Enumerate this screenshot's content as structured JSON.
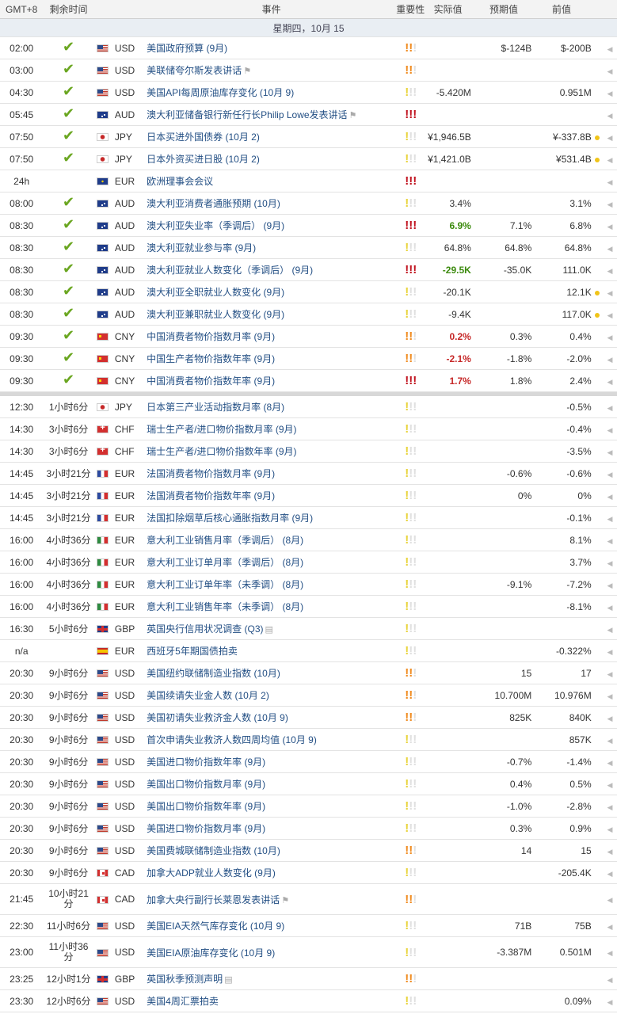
{
  "header": {
    "gmt": "GMT+8",
    "remaining": "剩余时间",
    "event": "事件",
    "importance": "重要性",
    "actual": "实际值",
    "forecast": "预期值",
    "previous": "前值"
  },
  "date_label": "星期四，10月 15",
  "importance_colors": {
    "low": "#e8d33a",
    "mid": "#f08a1e",
    "high": "#c0111d"
  },
  "rows_done": [
    {
      "time": "02:00",
      "status": "check",
      "flag": "USD",
      "cur": "USD",
      "event": "美国政府预算 (9月)",
      "imp": "mid",
      "actual": "",
      "act_style": "",
      "forecast": "$-124B",
      "previous": "$-200B",
      "dot": false
    },
    {
      "time": "03:00",
      "status": "check",
      "flag": "USD",
      "cur": "USD",
      "event": "美联储夸尔斯发表讲话",
      "icon": "speaker",
      "imp": "mid",
      "actual": "",
      "act_style": "",
      "forecast": "",
      "previous": "",
      "dot": false
    },
    {
      "time": "04:30",
      "status": "check",
      "flag": "USD",
      "cur": "USD",
      "event": "美国API每周原油库存变化 (10月 9)",
      "imp": "low",
      "actual": "-5.420M",
      "act_style": "",
      "forecast": "",
      "previous": "0.951M",
      "dot": false
    },
    {
      "time": "05:45",
      "status": "check",
      "flag": "AUD",
      "cur": "AUD",
      "event": "澳大利亚储备银行新任行长Philip Lowe发表讲话",
      "icon": "speaker",
      "imp": "high",
      "actual": "",
      "act_style": "",
      "forecast": "",
      "previous": "",
      "dot": false
    },
    {
      "time": "07:50",
      "status": "check",
      "flag": "JPY",
      "cur": "JPY",
      "event": "日本买进外国债券 (10月 2)",
      "imp": "low",
      "actual": "¥1,946.5B",
      "act_style": "",
      "forecast": "",
      "previous": "¥-337.8B",
      "dot": true
    },
    {
      "time": "07:50",
      "status": "check",
      "flag": "JPY",
      "cur": "JPY",
      "event": "日本外资买进日股 (10月 2)",
      "imp": "low",
      "actual": "¥1,421.0B",
      "act_style": "",
      "forecast": "",
      "previous": "¥531.4B",
      "dot": true
    },
    {
      "time": "24h",
      "status": "",
      "flag": "EUR",
      "cur": "EUR",
      "event": "欧洲理事会会议",
      "imp": "high",
      "actual": "",
      "act_style": "",
      "forecast": "",
      "previous": "",
      "dot": false
    },
    {
      "time": "08:00",
      "status": "check",
      "flag": "AUD",
      "cur": "AUD",
      "event": "澳大利亚消费者通胀预期 (10月)",
      "imp": "low",
      "actual": "3.4%",
      "act_style": "",
      "forecast": "",
      "previous": "3.1%",
      "dot": false
    },
    {
      "time": "08:30",
      "status": "check",
      "flag": "AUD",
      "cur": "AUD",
      "event": "澳大利亚失业率（季调后） (9月)",
      "imp": "high",
      "actual": "6.9%",
      "act_style": "good",
      "forecast": "7.1%",
      "previous": "6.8%",
      "dot": false
    },
    {
      "time": "08:30",
      "status": "check",
      "flag": "AUD",
      "cur": "AUD",
      "event": "澳大利亚就业参与率 (9月)",
      "imp": "low",
      "actual": "64.8%",
      "act_style": "",
      "forecast": "64.8%",
      "previous": "64.8%",
      "dot": false
    },
    {
      "time": "08:30",
      "status": "check",
      "flag": "AUD",
      "cur": "AUD",
      "event": "澳大利亚就业人数变化（季调后） (9月)",
      "imp": "high",
      "actual": "-29.5K",
      "act_style": "good",
      "forecast": "-35.0K",
      "previous": "111.0K",
      "dot": false
    },
    {
      "time": "08:30",
      "status": "check",
      "flag": "AUD",
      "cur": "AUD",
      "event": "澳大利亚全职就业人数变化 (9月)",
      "imp": "low",
      "actual": "-20.1K",
      "act_style": "",
      "forecast": "",
      "previous": "12.1K",
      "dot": true
    },
    {
      "time": "08:30",
      "status": "check",
      "flag": "AUD",
      "cur": "AUD",
      "event": "澳大利亚兼职就业人数变化 (9月)",
      "imp": "low",
      "actual": "-9.4K",
      "act_style": "",
      "forecast": "",
      "previous": "117.0K",
      "dot": true
    },
    {
      "time": "09:30",
      "status": "check",
      "flag": "CNY",
      "cur": "CNY",
      "event": "中国消费者物价指数月率 (9月)",
      "imp": "mid",
      "actual": "0.2%",
      "act_style": "bad",
      "forecast": "0.3%",
      "previous": "0.4%",
      "dot": false
    },
    {
      "time": "09:30",
      "status": "check",
      "flag": "CNY",
      "cur": "CNY",
      "event": "中国生产者物价指数年率 (9月)",
      "imp": "mid",
      "actual": "-2.1%",
      "act_style": "bad",
      "forecast": "-1.8%",
      "previous": "-2.0%",
      "dot": false
    },
    {
      "time": "09:30",
      "status": "check",
      "flag": "CNY",
      "cur": "CNY",
      "event": "中国消费者物价指数年率 (9月)",
      "imp": "high",
      "actual": "1.7%",
      "act_style": "bad",
      "forecast": "1.8%",
      "previous": "2.4%",
      "dot": false
    }
  ],
  "rows_upcoming": [
    {
      "time": "12:30",
      "rem": "1小时6分",
      "flag": "JPY",
      "cur": "JPY",
      "event": "日本第三产业活动指数月率 (8月)",
      "imp": "low",
      "forecast": "",
      "previous": "-0.5%"
    },
    {
      "time": "14:30",
      "rem": "3小时6分",
      "flag": "CHF",
      "cur": "CHF",
      "event": "瑞士生产者/进口物价指数月率 (9月)",
      "imp": "low",
      "forecast": "",
      "previous": "-0.4%"
    },
    {
      "time": "14:30",
      "rem": "3小时6分",
      "flag": "CHF",
      "cur": "CHF",
      "event": "瑞士生产者/进口物价指数年率 (9月)",
      "imp": "low",
      "forecast": "",
      "previous": "-3.5%"
    },
    {
      "time": "14:45",
      "rem": "3小时21分",
      "flag": "FR",
      "cur": "EUR",
      "event": "法国消费者物价指数月率 (9月)",
      "imp": "low",
      "forecast": "-0.6%",
      "previous": "-0.6%"
    },
    {
      "time": "14:45",
      "rem": "3小时21分",
      "flag": "FR",
      "cur": "EUR",
      "event": "法国消费者物价指数年率 (9月)",
      "imp": "low",
      "forecast": "0%",
      "previous": "0%"
    },
    {
      "time": "14:45",
      "rem": "3小时21分",
      "flag": "FR",
      "cur": "EUR",
      "event": "法国扣除烟草后核心通胀指数月率 (9月)",
      "imp": "low",
      "forecast": "",
      "previous": "-0.1%"
    },
    {
      "time": "16:00",
      "rem": "4小时36分",
      "flag": "IT",
      "cur": "EUR",
      "event": "意大利工业销售月率（季调后） (8月)",
      "imp": "low",
      "forecast": "",
      "previous": "8.1%"
    },
    {
      "time": "16:00",
      "rem": "4小时36分",
      "flag": "IT",
      "cur": "EUR",
      "event": "意大利工业订单月率（季调后） (8月)",
      "imp": "low",
      "forecast": "",
      "previous": "3.7%"
    },
    {
      "time": "16:00",
      "rem": "4小时36分",
      "flag": "IT",
      "cur": "EUR",
      "event": "意大利工业订单年率（未季调） (8月)",
      "imp": "low",
      "forecast": "-9.1%",
      "previous": "-7.2%"
    },
    {
      "time": "16:00",
      "rem": "4小时36分",
      "flag": "IT",
      "cur": "EUR",
      "event": "意大利工业销售年率（未季调） (8月)",
      "imp": "low",
      "forecast": "",
      "previous": "-8.1%"
    },
    {
      "time": "16:30",
      "rem": "5小时6分",
      "flag": "GBP",
      "cur": "GBP",
      "event": "英国央行信用状况调查 (Q3)",
      "icon": "doc",
      "imp": "low",
      "forecast": "",
      "previous": ""
    },
    {
      "time": "n/a",
      "rem": "",
      "flag": "ES",
      "cur": "EUR",
      "event": "西班牙5年期国债拍卖",
      "imp": "low",
      "forecast": "",
      "previous": "-0.322%"
    },
    {
      "time": "20:30",
      "rem": "9小时6分",
      "flag": "USD",
      "cur": "USD",
      "event": "美国纽约联储制造业指数 (10月)",
      "imp": "mid",
      "forecast": "15",
      "previous": "17"
    },
    {
      "time": "20:30",
      "rem": "9小时6分",
      "flag": "USD",
      "cur": "USD",
      "event": "美国续请失业金人数 (10月 2)",
      "imp": "mid",
      "forecast": "10.700M",
      "previous": "10.976M"
    },
    {
      "time": "20:30",
      "rem": "9小时6分",
      "flag": "USD",
      "cur": "USD",
      "event": "美国初请失业救济金人数 (10月 9)",
      "imp": "mid",
      "forecast": "825K",
      "previous": "840K"
    },
    {
      "time": "20:30",
      "rem": "9小时6分",
      "flag": "USD",
      "cur": "USD",
      "event": "首次申请失业救济人数四周均值 (10月 9)",
      "imp": "low",
      "forecast": "",
      "previous": "857K"
    },
    {
      "time": "20:30",
      "rem": "9小时6分",
      "flag": "USD",
      "cur": "USD",
      "event": "美国进口物价指数年率 (9月)",
      "imp": "low",
      "forecast": "-0.7%",
      "previous": "-1.4%"
    },
    {
      "time": "20:30",
      "rem": "9小时6分",
      "flag": "USD",
      "cur": "USD",
      "event": "美国出口物价指数月率 (9月)",
      "imp": "low",
      "forecast": "0.4%",
      "previous": "0.5%"
    },
    {
      "time": "20:30",
      "rem": "9小时6分",
      "flag": "USD",
      "cur": "USD",
      "event": "美国出口物价指数年率 (9月)",
      "imp": "low",
      "forecast": "-1.0%",
      "previous": "-2.8%"
    },
    {
      "time": "20:30",
      "rem": "9小时6分",
      "flag": "USD",
      "cur": "USD",
      "event": "美国进口物价指数月率 (9月)",
      "imp": "low",
      "forecast": "0.3%",
      "previous": "0.9%"
    },
    {
      "time": "20:30",
      "rem": "9小时6分",
      "flag": "USD",
      "cur": "USD",
      "event": "美国费城联储制造业指数 (10月)",
      "imp": "mid",
      "forecast": "14",
      "previous": "15"
    },
    {
      "time": "20:30",
      "rem": "9小时6分",
      "flag": "CAD",
      "cur": "CAD",
      "event": "加拿大ADP就业人数变化 (9月)",
      "imp": "low",
      "forecast": "",
      "previous": "-205.4K"
    },
    {
      "time": "21:45",
      "rem": "10小时21分",
      "flag": "CAD",
      "cur": "CAD",
      "event": "加拿大央行副行长莱恩发表讲话",
      "icon": "speaker",
      "imp": "mid",
      "forecast": "",
      "previous": "",
      "tall": true
    },
    {
      "time": "22:30",
      "rem": "11小时6分",
      "flag": "USD",
      "cur": "USD",
      "event": "美国EIA天然气库存变化 (10月 9)",
      "imp": "low",
      "forecast": "71B",
      "previous": "75B"
    },
    {
      "time": "23:00",
      "rem": "11小时36分",
      "flag": "USD",
      "cur": "USD",
      "event": "美国EIA原油库存变化 (10月 9)",
      "imp": "low",
      "forecast": "-3.387M",
      "previous": "0.501M",
      "tall": true
    },
    {
      "time": "23:25",
      "rem": "12小时1分",
      "flag": "GBP",
      "cur": "GBP",
      "event": "英国秋季预测声明",
      "icon": "doc",
      "imp": "mid",
      "forecast": "",
      "previous": ""
    },
    {
      "time": "23:30",
      "rem": "12小时6分",
      "flag": "USD",
      "cur": "USD",
      "event": "美国4周汇票拍卖",
      "imp": "low",
      "forecast": "",
      "previous": "0.09%"
    }
  ]
}
